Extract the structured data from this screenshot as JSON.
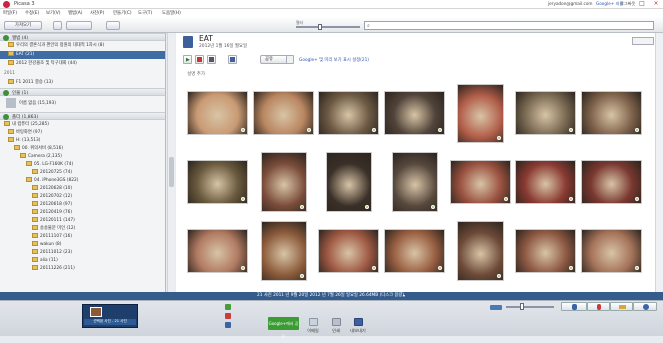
{
  "window": {
    "title": "Picasa 3",
    "user_label": "jeryadon@gmail.com",
    "google_plus_label": "Google+ 지원",
    "signout_label": "로그아웃"
  },
  "menu": [
    "파일(F)",
    "수정(E)",
    "보기(V)",
    "앨범(A)",
    "사진(P)",
    "만들기(C)",
    "도구(T)",
    "도움말(H)"
  ],
  "toolbar": {
    "import_label": "가져오기",
    "search_placeholder": "",
    "filter_label": "필터"
  },
  "sidebar": {
    "sections": [
      {
        "label": "앨범 (4)",
        "rows": [
          {
            "label": "우리의 결혼식과 편안의 정원의 대대적 1차시 (8)",
            "selected": false
          },
          {
            "label": "EAT (21)",
            "selected": true
          },
          {
            "label": "2012 한강몰조 및 탁구대회 (44)",
            "selected": false
          }
        ]
      },
      {
        "label": "2011",
        "rows": [
          {
            "label": "F1 2011 결승 (13)",
            "selected": false
          }
        ]
      },
      {
        "label": "인물 (1)",
        "rows": [
          {
            "label": "이름 없음 (15,193)",
            "selected": false
          }
        ]
      },
      {
        "label": "폴더 (1,863)",
        "rows": [
          {
            "label": "내 컴퓨터 (25,285)"
          },
          {
            "label": "바탕화면 (97)"
          },
          {
            "label": "H: (13,513)"
          },
          {
            "label": "00. 위의서비 (8,516)"
          },
          {
            "label": "Camera (2,135)"
          },
          {
            "label": "05. LG-F160K (74)"
          },
          {
            "label": "20120725 (74)"
          },
          {
            "label": "04. iPhone3GS (822)"
          },
          {
            "label": "20120628 (10)"
          },
          {
            "label": "20120702 (12)"
          },
          {
            "label": "20120618 (97)"
          },
          {
            "label": "20120419 (76)"
          },
          {
            "label": "20120111 (147)"
          },
          {
            "label": "송송불문 미인 (12)"
          },
          {
            "label": "20111107 (16)"
          },
          {
            "label": "wakun (8)"
          },
          {
            "label": "20111012 (23)"
          },
          {
            "label": "alia (11)"
          },
          {
            "label": "20111226 (211)"
          }
        ]
      }
    ]
  },
  "album": {
    "title": "EAT",
    "meta": "2012년 1월 16일 월요일",
    "caption_placeholder": "설명 추가",
    "share_label": "공유",
    "share_link": "Google+ 및 미리 보기 표시 설정(21)"
  },
  "photos": [
    {
      "bg": "#c99a74"
    },
    {
      "bg": "#b98660"
    },
    {
      "bg": "#6d5a44"
    },
    {
      "bg": "#51443a"
    },
    {
      "bg": "#b15d49"
    },
    {
      "bg": "#7a6a53"
    },
    {
      "bg": "#80644c"
    },
    {
      "bg": "#6a5a3e"
    },
    {
      "bg": "#7a4c3a"
    },
    {
      "bg": "#3a3028"
    },
    {
      "bg": "#56483d"
    },
    {
      "bg": "#9a5140"
    },
    {
      "bg": "#8a3a32"
    },
    {
      "bg": "#7a3830"
    },
    {
      "bg": "#b17a62"
    },
    {
      "bg": "#8c5c3c"
    },
    {
      "bg": "#a05a44"
    },
    {
      "bg": "#9b6043"
    },
    {
      "bg": "#6d4a38"
    },
    {
      "bg": "#8f5a44"
    },
    {
      "bg": "#a5735a"
    }
  ],
  "status": {
    "text": "21 사진   2011 년 9월 20일   2012 년 7월 26일 일요일   26.64MB (디스크 용량)"
  },
  "bottom": {
    "tray_label": "선택된 사진 - 21 사진",
    "gplus_label": "Google+에서 공유",
    "buttons": [
      "이메일",
      "인쇄",
      "내보내기"
    ]
  },
  "colors": {
    "accent": "#355c8b",
    "selected": "#3f6ca3",
    "section_circle": "#3f8e3a",
    "gplus": "#3d9b35"
  }
}
